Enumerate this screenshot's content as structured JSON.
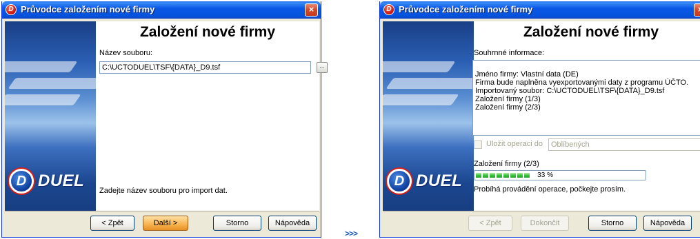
{
  "left_window": {
    "title": "Průvodce založením nové firmy",
    "close_glyph": "×",
    "app_icon_letter": "D",
    "logo_letter": "D",
    "logo_word": "DUEL",
    "heading": "Založení nové firmy",
    "file_label": "Název souboru:",
    "file_value": "C:\\UCTODUEL\\TSF\\{DATA}_D9.tsf",
    "browse_glyph": "...",
    "hint": "Zadejte název souboru pro import dat.",
    "buttons": {
      "back": "< Zpět",
      "next": "Další >",
      "cancel": "Storno",
      "help": "Nápověda"
    }
  },
  "right_window": {
    "title": "Průvodce založením nové firmy",
    "close_glyph": "×",
    "app_icon_letter": "D",
    "logo_letter": "D",
    "logo_word": "DUEL",
    "heading": "Založení nové firmy",
    "summary_label": "Souhrnné informace:",
    "summary_lines": [
      "Jméno firmy: Vlastní data (DE)",
      "Firma bude naplněna vyexportovanými daty z programu ÚČTO.",
      "Importovaný soubor: C:\\UCTODUEL\\TSF\\{DATA}_D9.tsf",
      "Založení firmy (1/3)",
      "Založení firmy (2/3)"
    ],
    "save_checkbox_label": "Uložit operaci do",
    "save_combo_value": "Oblíbených",
    "progress_label": "Založení firmy (2/3)",
    "progress_percent_text": "33 %",
    "progress_fraction": 0.33,
    "status_text": "Probíhá provádění operace, počkejte prosím.",
    "buttons": {
      "back": "< Zpět",
      "finish": "Dokončit",
      "cancel": "Storno",
      "help": "Nápověda"
    }
  },
  "transition_marker": ">>>"
}
